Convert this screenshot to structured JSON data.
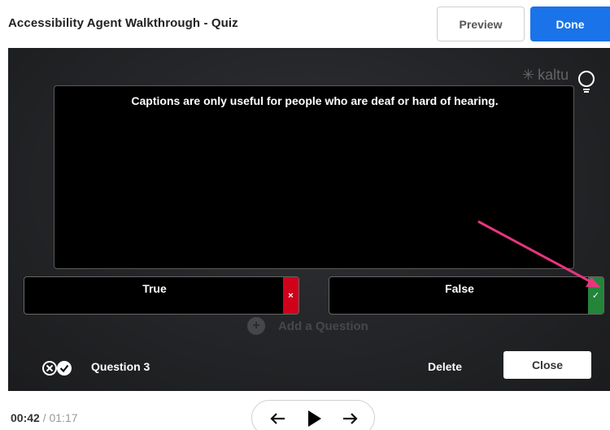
{
  "header": {
    "title": "Accessibility Agent Walkthrough - Quiz",
    "preview_label": "Preview",
    "done_label": "Done"
  },
  "player": {
    "brand": "kaltu",
    "question": {
      "text": "Captions are only useful for people who are deaf or hard of hearing."
    },
    "answers": [
      {
        "label": "True",
        "status": "incorrect",
        "status_glyph": "×"
      },
      {
        "label": "False",
        "status": "correct",
        "status_glyph": "✓"
      }
    ],
    "background_overlay_text": "Add a Question",
    "question_counter": "Question 3",
    "delete_label": "Delete",
    "close_label": "Close"
  },
  "playback": {
    "current_time": "00:42",
    "separator": "/",
    "total_time": "01:17"
  },
  "icons": {
    "quiz": "quiz-status-icon",
    "lightbulb": "lightbulb-icon",
    "prev": "arrow-left-icon",
    "play": "play-icon",
    "next": "arrow-right-icon"
  },
  "colors": {
    "primary": "#1a73e8",
    "incorrect": "#d0021b",
    "correct": "#23843a",
    "annotation_arrow": "#e8347f"
  }
}
